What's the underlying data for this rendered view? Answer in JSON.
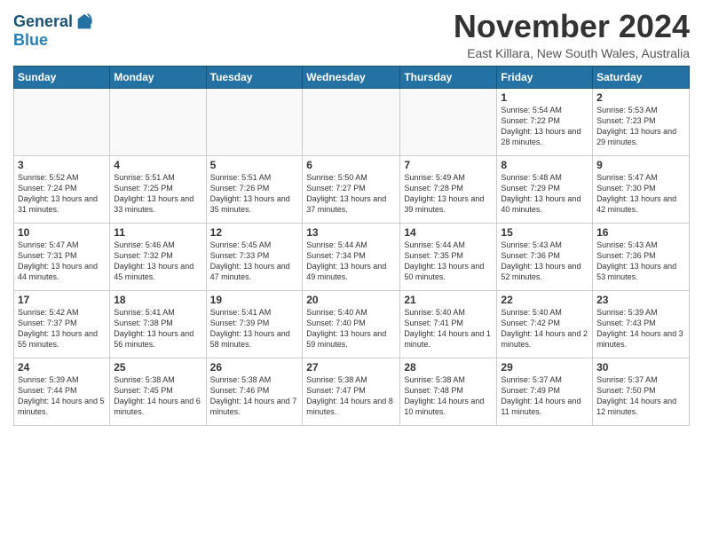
{
  "header": {
    "logo_line1": "General",
    "logo_line2": "Blue",
    "month_title": "November 2024",
    "location": "East Killara, New South Wales, Australia"
  },
  "weekdays": [
    "Sunday",
    "Monday",
    "Tuesday",
    "Wednesday",
    "Thursday",
    "Friday",
    "Saturday"
  ],
  "weeks": [
    [
      {
        "day": "",
        "info": ""
      },
      {
        "day": "",
        "info": ""
      },
      {
        "day": "",
        "info": ""
      },
      {
        "day": "",
        "info": ""
      },
      {
        "day": "",
        "info": ""
      },
      {
        "day": "1",
        "info": "Sunrise: 5:54 AM\nSunset: 7:22 PM\nDaylight: 13 hours and 28 minutes."
      },
      {
        "day": "2",
        "info": "Sunrise: 5:53 AM\nSunset: 7:23 PM\nDaylight: 13 hours and 29 minutes."
      }
    ],
    [
      {
        "day": "3",
        "info": "Sunrise: 5:52 AM\nSunset: 7:24 PM\nDaylight: 13 hours and 31 minutes."
      },
      {
        "day": "4",
        "info": "Sunrise: 5:51 AM\nSunset: 7:25 PM\nDaylight: 13 hours and 33 minutes."
      },
      {
        "day": "5",
        "info": "Sunrise: 5:51 AM\nSunset: 7:26 PM\nDaylight: 13 hours and 35 minutes."
      },
      {
        "day": "6",
        "info": "Sunrise: 5:50 AM\nSunset: 7:27 PM\nDaylight: 13 hours and 37 minutes."
      },
      {
        "day": "7",
        "info": "Sunrise: 5:49 AM\nSunset: 7:28 PM\nDaylight: 13 hours and 39 minutes."
      },
      {
        "day": "8",
        "info": "Sunrise: 5:48 AM\nSunset: 7:29 PM\nDaylight: 13 hours and 40 minutes."
      },
      {
        "day": "9",
        "info": "Sunrise: 5:47 AM\nSunset: 7:30 PM\nDaylight: 13 hours and 42 minutes."
      }
    ],
    [
      {
        "day": "10",
        "info": "Sunrise: 5:47 AM\nSunset: 7:31 PM\nDaylight: 13 hours and 44 minutes."
      },
      {
        "day": "11",
        "info": "Sunrise: 5:46 AM\nSunset: 7:32 PM\nDaylight: 13 hours and 45 minutes."
      },
      {
        "day": "12",
        "info": "Sunrise: 5:45 AM\nSunset: 7:33 PM\nDaylight: 13 hours and 47 minutes."
      },
      {
        "day": "13",
        "info": "Sunrise: 5:44 AM\nSunset: 7:34 PM\nDaylight: 13 hours and 49 minutes."
      },
      {
        "day": "14",
        "info": "Sunrise: 5:44 AM\nSunset: 7:35 PM\nDaylight: 13 hours and 50 minutes."
      },
      {
        "day": "15",
        "info": "Sunrise: 5:43 AM\nSunset: 7:36 PM\nDaylight: 13 hours and 52 minutes."
      },
      {
        "day": "16",
        "info": "Sunrise: 5:43 AM\nSunset: 7:36 PM\nDaylight: 13 hours and 53 minutes."
      }
    ],
    [
      {
        "day": "17",
        "info": "Sunrise: 5:42 AM\nSunset: 7:37 PM\nDaylight: 13 hours and 55 minutes."
      },
      {
        "day": "18",
        "info": "Sunrise: 5:41 AM\nSunset: 7:38 PM\nDaylight: 13 hours and 56 minutes."
      },
      {
        "day": "19",
        "info": "Sunrise: 5:41 AM\nSunset: 7:39 PM\nDaylight: 13 hours and 58 minutes."
      },
      {
        "day": "20",
        "info": "Sunrise: 5:40 AM\nSunset: 7:40 PM\nDaylight: 13 hours and 59 minutes."
      },
      {
        "day": "21",
        "info": "Sunrise: 5:40 AM\nSunset: 7:41 PM\nDaylight: 14 hours and 1 minute."
      },
      {
        "day": "22",
        "info": "Sunrise: 5:40 AM\nSunset: 7:42 PM\nDaylight: 14 hours and 2 minutes."
      },
      {
        "day": "23",
        "info": "Sunrise: 5:39 AM\nSunset: 7:43 PM\nDaylight: 14 hours and 3 minutes."
      }
    ],
    [
      {
        "day": "24",
        "info": "Sunrise: 5:39 AM\nSunset: 7:44 PM\nDaylight: 14 hours and 5 minutes."
      },
      {
        "day": "25",
        "info": "Sunrise: 5:38 AM\nSunset: 7:45 PM\nDaylight: 14 hours and 6 minutes."
      },
      {
        "day": "26",
        "info": "Sunrise: 5:38 AM\nSunset: 7:46 PM\nDaylight: 14 hours and 7 minutes."
      },
      {
        "day": "27",
        "info": "Sunrise: 5:38 AM\nSunset: 7:47 PM\nDaylight: 14 hours and 8 minutes."
      },
      {
        "day": "28",
        "info": "Sunrise: 5:38 AM\nSunset: 7:48 PM\nDaylight: 14 hours and 10 minutes."
      },
      {
        "day": "29",
        "info": "Sunrise: 5:37 AM\nSunset: 7:49 PM\nDaylight: 14 hours and 11 minutes."
      },
      {
        "day": "30",
        "info": "Sunrise: 5:37 AM\nSunset: 7:50 PM\nDaylight: 14 hours and 12 minutes."
      }
    ]
  ]
}
